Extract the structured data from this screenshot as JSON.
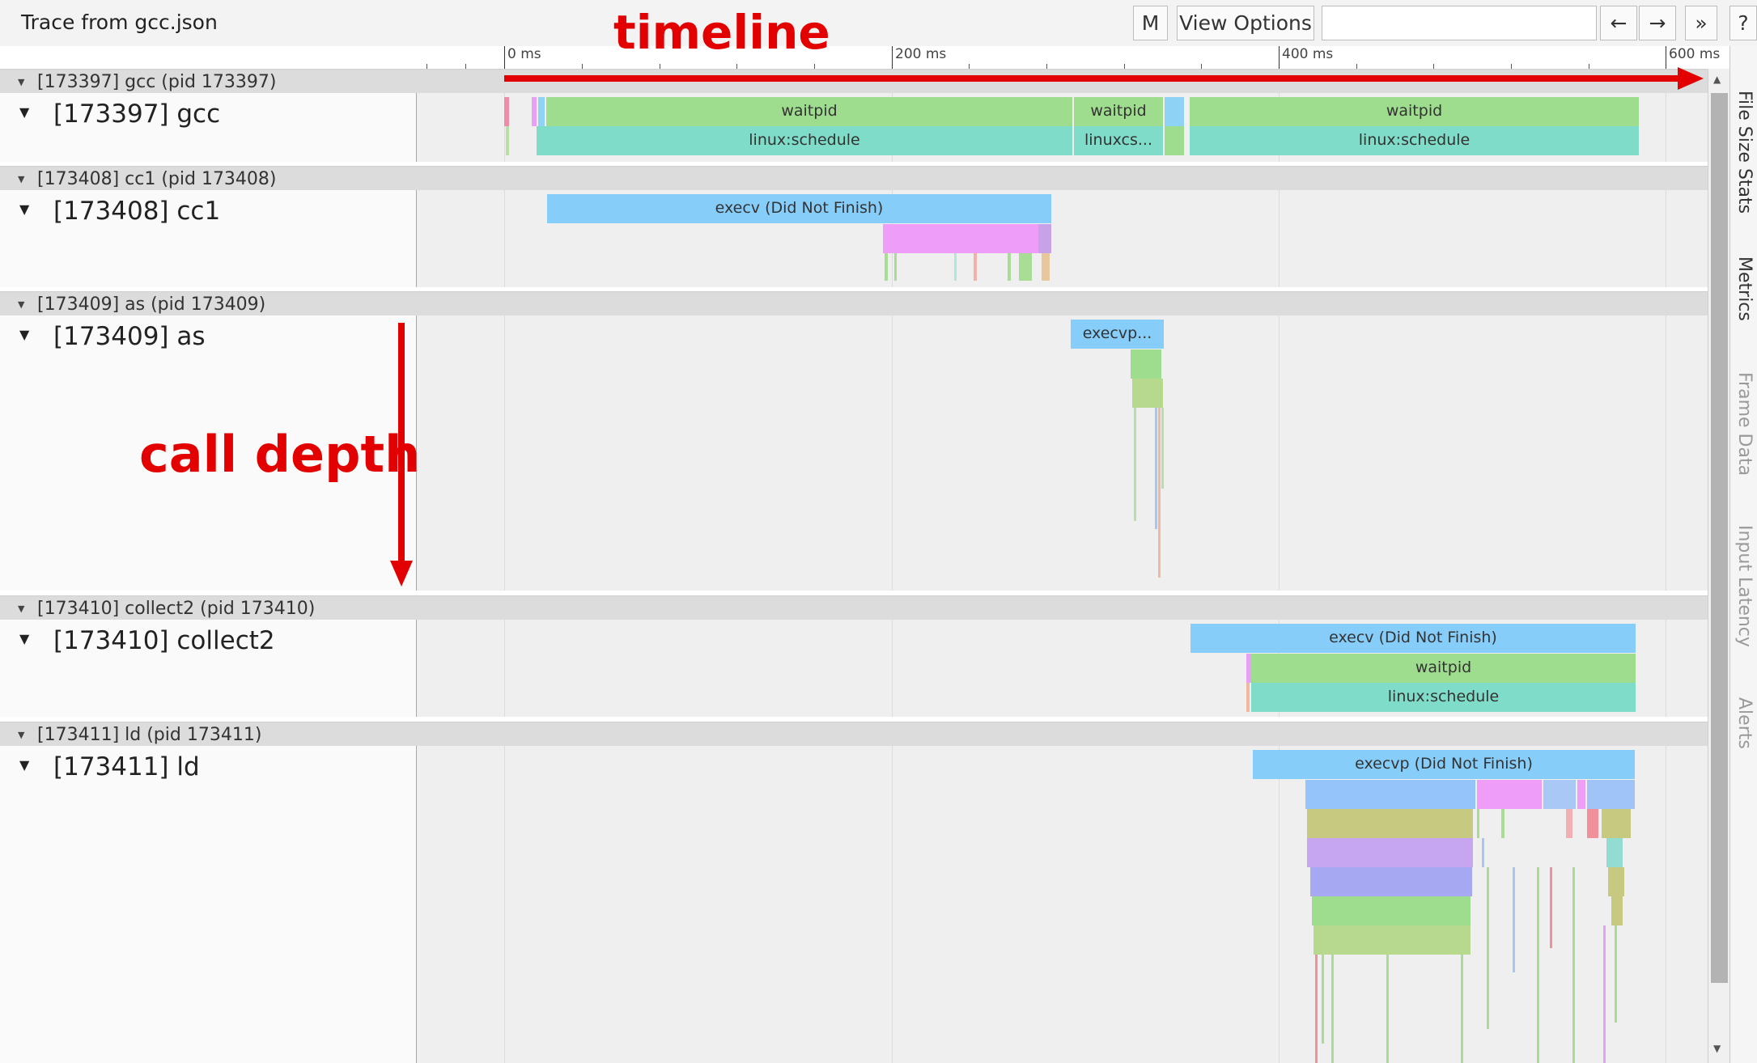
{
  "header": {
    "title": "Trace from gcc.json",
    "m_button": "M",
    "view_options": "View Options",
    "search_value": "",
    "prev_arrow": "←",
    "next_arrow": "→",
    "expand": "»",
    "help": "?"
  },
  "ruler": {
    "labels": [
      "0 ms",
      "200 ms",
      "400 ms",
      "600 ms"
    ]
  },
  "processes": [
    {
      "header": "[173397] gcc (pid 173397)",
      "thread": "[173397] gcc",
      "slices": [
        "waitpid",
        "waitpid",
        "waitpid",
        "linux:schedule",
        "linuxcs...",
        "linux:schedule"
      ]
    },
    {
      "header": "[173408] cc1 (pid 173408)",
      "thread": "[173408] cc1",
      "slices": [
        "execv (Did Not Finish)"
      ]
    },
    {
      "header": "[173409] as (pid 173409)",
      "thread": "[173409] as",
      "slices": [
        "execvp..."
      ]
    },
    {
      "header": "[173410] collect2 (pid 173410)",
      "thread": "[173410] collect2",
      "slices": [
        "execv (Did Not Finish)",
        "waitpid",
        "linux:schedule"
      ]
    },
    {
      "header": "[173411] ld (pid 173411)",
      "thread": "[173411] ld",
      "slices": [
        "execvp (Did Not Finish)"
      ]
    }
  ],
  "side_tabs": [
    "File Size Stats",
    "Metrics",
    "Frame Data",
    "Input Latency",
    "Alerts"
  ],
  "annotations": {
    "timeline": "timeline",
    "call_depth": "call depth"
  },
  "colors": {
    "waitpid": "#9edc8e",
    "schedule": "#7fdcc8",
    "execv": "#87cdfa",
    "pink": "#f0a0ff",
    "red_annotation": "#e30000"
  }
}
